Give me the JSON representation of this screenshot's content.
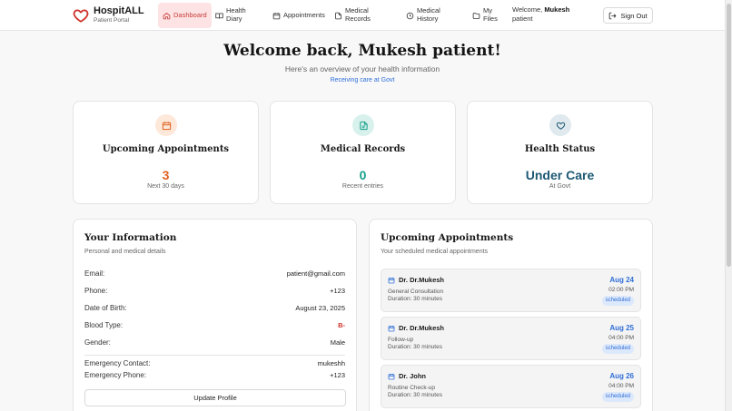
{
  "brand": {
    "name": "HospitALL",
    "subtitle": "Patient Portal"
  },
  "nav": {
    "items": [
      {
        "label": "Dashboard",
        "icon": "home-icon",
        "active": true
      },
      {
        "label": "Health Diary",
        "icon": "book-icon",
        "active": false
      },
      {
        "label": "Appointments",
        "icon": "calendar-icon",
        "active": false
      },
      {
        "label": "Medical Records",
        "icon": "file-icon",
        "active": false
      },
      {
        "label": "Medical History",
        "icon": "clock-icon",
        "active": false
      },
      {
        "label": "My Files",
        "icon": "folder-icon",
        "active": false
      }
    ],
    "welcome_prefix": "Welcome,",
    "welcome_name": "Mukesh",
    "welcome_suffix": "patient",
    "signout_label": "Sign Out"
  },
  "hero": {
    "title": "Welcome back, Mukesh patient!",
    "subtitle": "Here's an overview of your health information",
    "care": "Receiving care at Govt"
  },
  "stats": [
    {
      "label": "Upcoming Appointments",
      "value": "3",
      "note": "Next 30 days",
      "icon": "calendar-icon",
      "color": "#e0601f",
      "bg": "#fde8da"
    },
    {
      "label": "Medical Records",
      "value": "0",
      "note": "Recent entries",
      "icon": "file-icon",
      "color": "#17a08a",
      "bg": "#d8f1ec"
    },
    {
      "label": "Health Status",
      "value": "Under Care",
      "note": "At Govt",
      "icon": "heart-icon",
      "color": "#1d5873",
      "bg": "#dfe9ee"
    }
  ],
  "info": {
    "title": "Your Information",
    "subtitle": "Personal and medical details",
    "rows": [
      {
        "label": "Email:",
        "value": "patient@gmail.com"
      },
      {
        "label": "Phone:",
        "value": "+123"
      },
      {
        "label": "Date of Birth:",
        "value": "August 23, 2025"
      },
      {
        "label": "Blood Type:",
        "value": "B-"
      },
      {
        "label": "Gender:",
        "value": "Male"
      },
      {
        "label": "Emergency Contact:",
        "value": "mukeshh"
      },
      {
        "label": "Emergency Phone:",
        "value": "+123"
      }
    ],
    "update_label": "Update Profile"
  },
  "appointments": {
    "title": "Upcoming Appointments",
    "subtitle": "Your scheduled medical appointments",
    "items": [
      {
        "doctor": "Dr. Dr.Mukesh",
        "type": "General Consultation",
        "duration": "Duration: 30 minutes",
        "date": "Aug 24",
        "time": "02:00 PM",
        "status": "scheduled"
      },
      {
        "doctor": "Dr. Dr.Mukesh",
        "type": "Follow-up",
        "duration": "Duration: 30 minutes",
        "date": "Aug 25",
        "time": "04:00 PM",
        "status": "scheduled"
      },
      {
        "doctor": "Dr. John",
        "type": "Routine Check-up",
        "duration": "Duration: 30 minutes",
        "date": "Aug 26",
        "time": "04:00 PM",
        "status": "scheduled"
      }
    ]
  },
  "colors": {
    "accent": "#c73b3b",
    "link": "#2f6fd6",
    "blood": "#d0342c"
  }
}
